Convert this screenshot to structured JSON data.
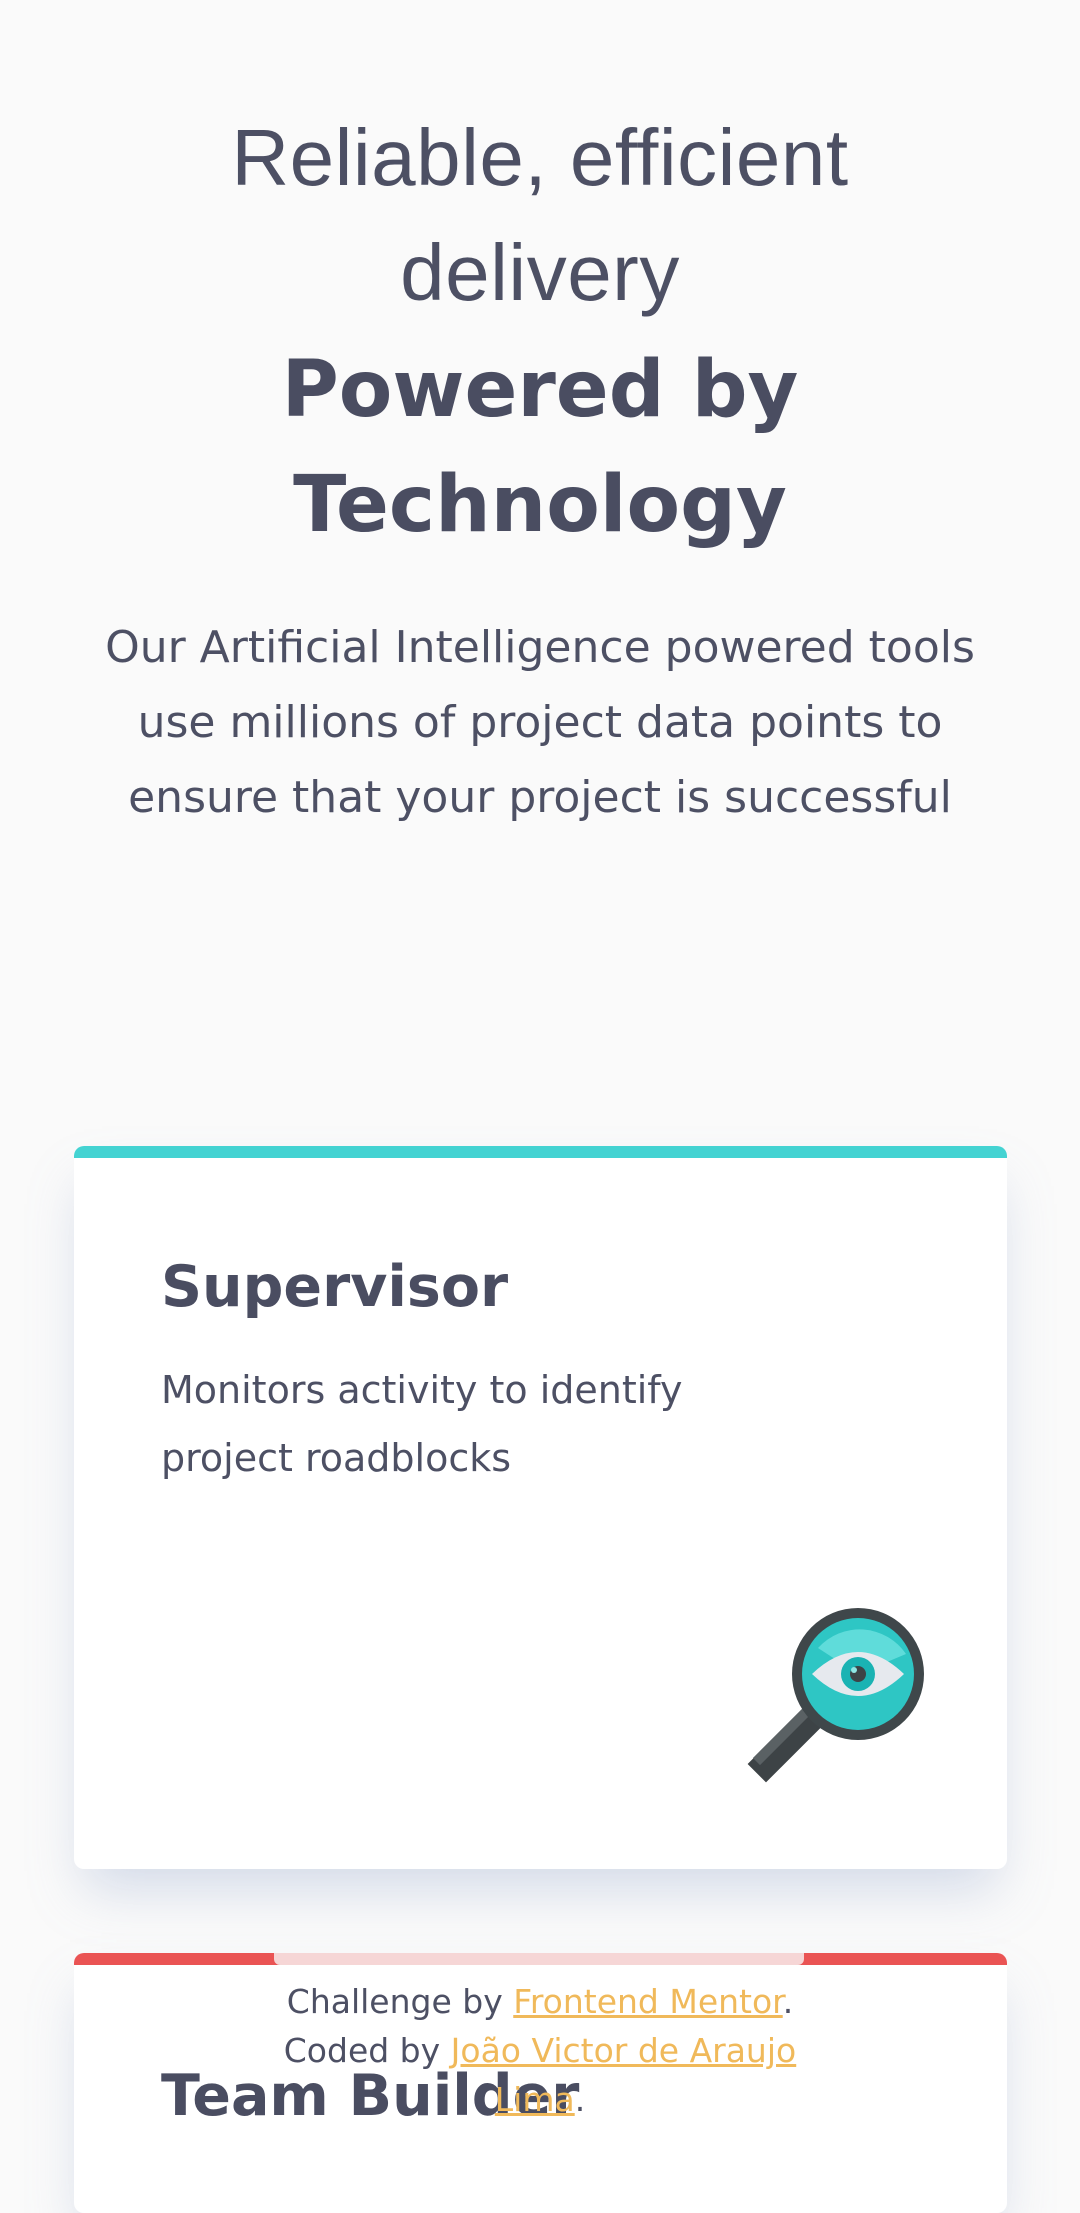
{
  "hero": {
    "line1": "Reliable, efficient",
    "line2": "delivery",
    "bold_line1": "Powered by",
    "bold_line2": "Technology",
    "description": "Our Artificial Intelligence powered tools use millions of project data points to ensure that your project is successful"
  },
  "cards": [
    {
      "title": "Supervisor",
      "description": "Monitors activity to identify project roadblocks",
      "accent": "#44d3d2",
      "icon": "magnifier-eye-icon"
    },
    {
      "title": "Team Builder",
      "accent": "#ea5454"
    }
  ],
  "attribution": {
    "prefix": "Challenge by ",
    "link1": "Frontend Mentor",
    "middle": ". Coded by ",
    "link2": "João Victor de Araujo Lima",
    "suffix": "."
  },
  "colors": {
    "background": "#fafafa",
    "text": "#4d5064",
    "link": "#f0b95a"
  }
}
